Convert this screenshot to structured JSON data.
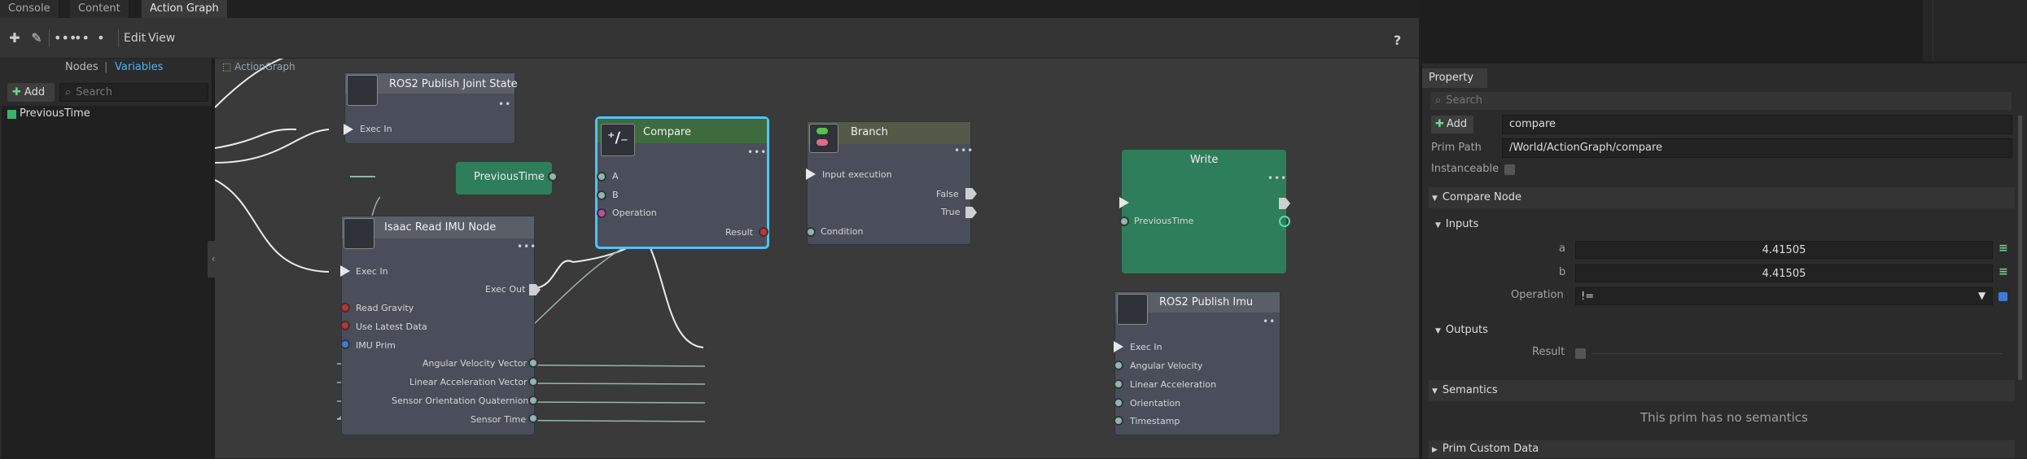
{
  "tabs": [
    "Console",
    "Content",
    "Action Graph"
  ],
  "toolbar": {
    "edit": "Edit",
    "view": "View",
    "help": "?"
  },
  "left_panel": {
    "subtabs": [
      "Nodes",
      "Variables"
    ],
    "separator": "|",
    "add_label": "Add",
    "search_placeholder": "Search",
    "variables": [
      "PreviousTime"
    ]
  },
  "graph": {
    "breadcrumb": "ActionGraph",
    "nodes": {
      "ros2_joint": {
        "title": "ROS2 Publish Joint State",
        "pins": [
          "Exec In"
        ]
      },
      "imu_read": {
        "title": "Isaac Read IMU Node",
        "inputs": [
          "Exec In",
          "Read Gravity",
          "Use Latest Data",
          "IMU Prim"
        ],
        "outputs": [
          "Exec Out",
          "Angular Velocity Vector",
          "Linear Acceleration Vector",
          "Sensor Orientation Quaternion",
          "Sensor Time"
        ]
      },
      "previous_time": {
        "title": "PreviousTime"
      },
      "compare": {
        "title": "Compare",
        "inputs": [
          "A",
          "B",
          "Operation"
        ],
        "outputs": [
          "Result"
        ]
      },
      "branch": {
        "title": "Branch",
        "inputs": [
          "Input execution",
          "Condition"
        ],
        "outputs": [
          "False",
          "True"
        ]
      },
      "write": {
        "title": "Write",
        "inputs": [
          "PreviousTime"
        ]
      },
      "ros2_imu": {
        "title": "ROS2 Publish Imu",
        "inputs": [
          "Exec In",
          "Angular Velocity",
          "Linear Acceleration",
          "Orientation",
          "Timestamp"
        ]
      }
    }
  },
  "property_panel": {
    "tab": "Property",
    "search_placeholder": "Search",
    "add_label": "Add",
    "name_value": "compare",
    "prim_path_label": "Prim Path",
    "prim_path_value": "/World/ActionGraph/compare",
    "instanceable_label": "Instanceable",
    "compare_section": "Compare Node",
    "inputs_label": "Inputs",
    "a_label": "a",
    "a_value": "4.41505",
    "b_label": "b",
    "b_value": "4.41505",
    "operation_label": "Operation",
    "operation_value": "!=",
    "outputs_label": "Outputs",
    "result_label": "Result",
    "semantics_section": "Semantics",
    "semantics_empty": "This prim has no semantics",
    "custom_data_section": "Prim Custom Data"
  },
  "colors": {
    "compare_border": "#4fc3f7",
    "write_node": "#2e7d5b",
    "previous_time_node": "#2e7d5b",
    "compare_head": "#3d6b3d",
    "branch_head": "#555a48",
    "accent_text": "#4fb3f0"
  }
}
